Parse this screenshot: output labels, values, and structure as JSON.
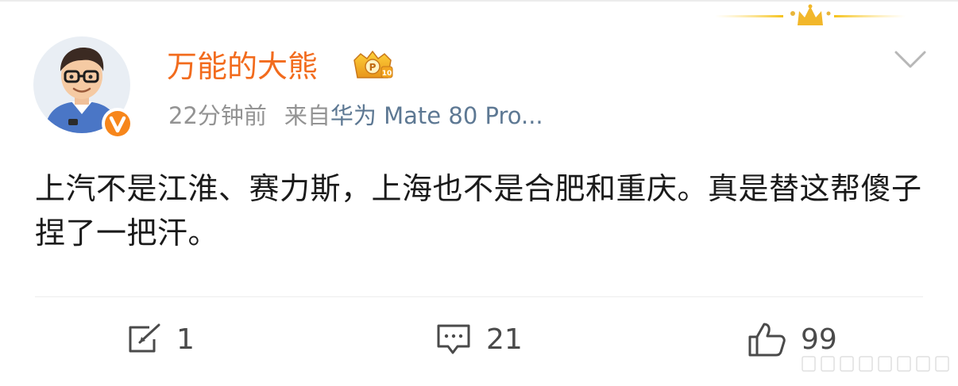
{
  "post": {
    "author": "万能的大熊",
    "time": "22分钟前",
    "source_prefix": "来自",
    "source_device": "华为 Mate 80 Pro...",
    "text": "上汽不是江淮、赛力斯，上海也不是合肥和重庆。真是替这帮傻子捏了一把汗。"
  },
  "actions": {
    "repost_count": "1",
    "comment_count": "21",
    "like_count": "99"
  },
  "icons": {
    "avatar": "cartoon-man-avatar",
    "verified": "verified-v-badge",
    "vip": "vip-crown-badge",
    "menu": "chevron-down-icon",
    "repost": "repost-icon",
    "comment": "comment-icon",
    "like": "thumbs-up-icon"
  },
  "colors": {
    "author": "#f26b1d",
    "meta": "#939393",
    "device": "#5d7893",
    "text": "#1a1a1a",
    "accent_gold": "#f5b800"
  }
}
